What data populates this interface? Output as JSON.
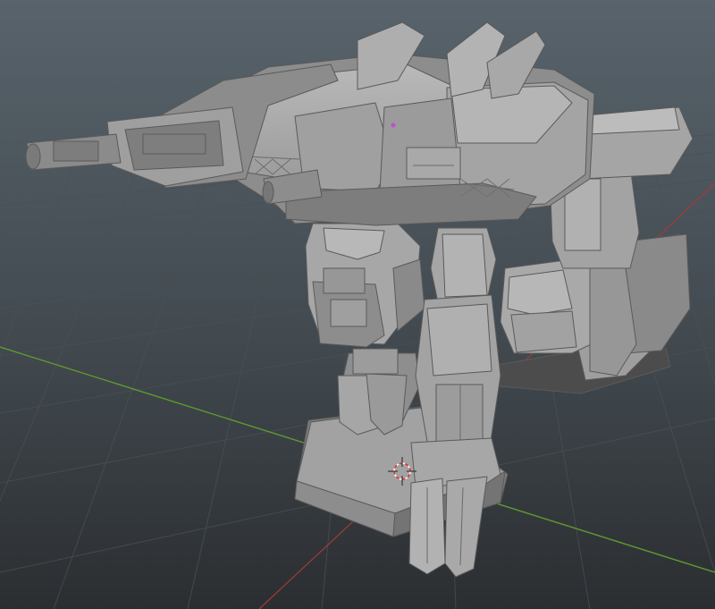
{
  "viewport": {
    "name": "3D Viewport",
    "background_top": "#58636b",
    "background_bottom": "#2a2d30",
    "grid_color": "#4a4f53",
    "x_axis_color": "#a33a3a",
    "y_axis_color": "#5f9a2f",
    "object_color": "#9a9a9a",
    "object_origin_color": "#c04ed0",
    "cursor_color": "#e03030"
  },
  "scene": {
    "object": "mech-robot",
    "parts": [
      "cannon",
      "torso",
      "left-arm",
      "right-leg",
      "left-leg",
      "pedestal",
      "right-foot"
    ],
    "tools": [
      "3d-cursor",
      "object-origin"
    ]
  }
}
